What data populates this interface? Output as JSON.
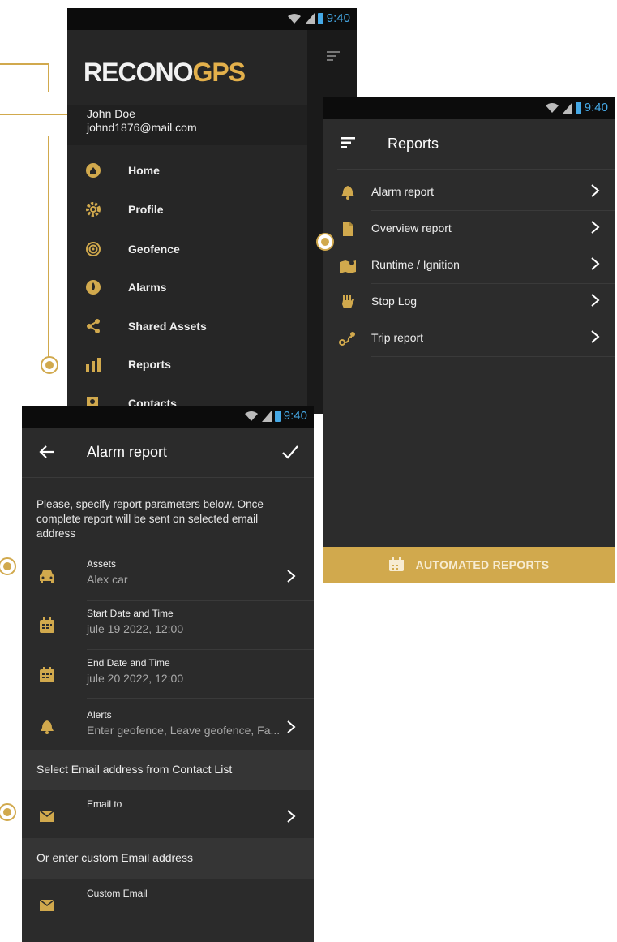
{
  "status": {
    "time": "9:40"
  },
  "drawer": {
    "logo_left": "RECONO",
    "logo_right": "GPS",
    "user_name": "John Doe",
    "user_email": "johnd1876@mail.com",
    "items": [
      {
        "label": "Home",
        "icon": "home-icon"
      },
      {
        "label": "Profile",
        "icon": "gear-icon"
      },
      {
        "label": "Geofence",
        "icon": "geofence-icon"
      },
      {
        "label": "Alarms",
        "icon": "alarm-drop-icon"
      },
      {
        "label": "Shared Assets",
        "icon": "share-icon"
      },
      {
        "label": "Reports",
        "icon": "bar-chart-icon"
      },
      {
        "label": "Contacts",
        "icon": "contacts-icon"
      }
    ]
  },
  "reports": {
    "title": "Reports",
    "items": [
      {
        "label": "Alarm report",
        "icon": "bell-icon"
      },
      {
        "label": "Overview report",
        "icon": "document-icon"
      },
      {
        "label": "Runtime / Ignition",
        "icon": "map-pin-icon"
      },
      {
        "label": "Stop Log",
        "icon": "hand-icon"
      },
      {
        "label": "Trip report",
        "icon": "route-icon"
      }
    ],
    "automated_label": "AUTOMATED REPORTS"
  },
  "alarm": {
    "title": "Alarm report",
    "description": "Please, specify report parameters below. Once complete report will be sent on selected email address",
    "fields": [
      {
        "label": "Assets",
        "value": "Alex car",
        "icon": "car-icon"
      },
      {
        "label": "Start Date and Time",
        "value": "jule 19 2022, 12:00",
        "icon": "calendar-icon"
      },
      {
        "label": "End Date and Time",
        "value": "jule 20 2022, 12:00",
        "icon": "calendar-icon"
      },
      {
        "label": "Alerts",
        "value": "Enter geofence, Leave geofence, Fa...",
        "icon": "bell-icon"
      }
    ],
    "section_contact": "Select Email address from Contact List",
    "email_to_label": "Email to",
    "section_custom": "Or enter custom Email address",
    "custom_email_label": "Custom Email"
  },
  "colors": {
    "accent": "#d1a94d",
    "status_blue": "#46a9e6",
    "background": "#2a2a2a"
  }
}
